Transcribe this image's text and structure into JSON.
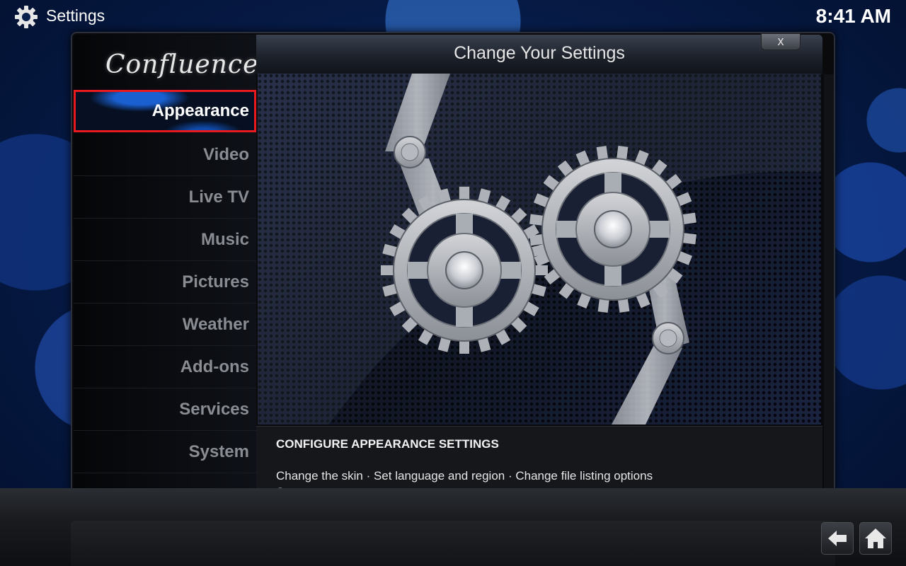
{
  "topbar": {
    "title": "Settings",
    "time": "8:41 AM"
  },
  "sidebar": {
    "logo": "Confluence",
    "items": [
      {
        "label": "Appearance",
        "active": true
      },
      {
        "label": "Video"
      },
      {
        "label": "Live TV"
      },
      {
        "label": "Music"
      },
      {
        "label": "Pictures"
      },
      {
        "label": "Weather"
      },
      {
        "label": "Add-ons"
      },
      {
        "label": "Services"
      },
      {
        "label": "System"
      }
    ]
  },
  "dialog": {
    "title": "Change Your Settings",
    "close_label": "x"
  },
  "description": {
    "heading": "CONFIGURE APPEARANCE SETTINGS",
    "line1": "Change the skin · Set language and region · Change file listing options",
    "line2": "Set up a screensaver"
  },
  "colors": {
    "highlight_border": "#e8191f",
    "accent_blue": "#1e6ef0"
  },
  "icons": {
    "settings": "gear-icon",
    "back": "back-arrow-icon",
    "home": "home-icon"
  }
}
